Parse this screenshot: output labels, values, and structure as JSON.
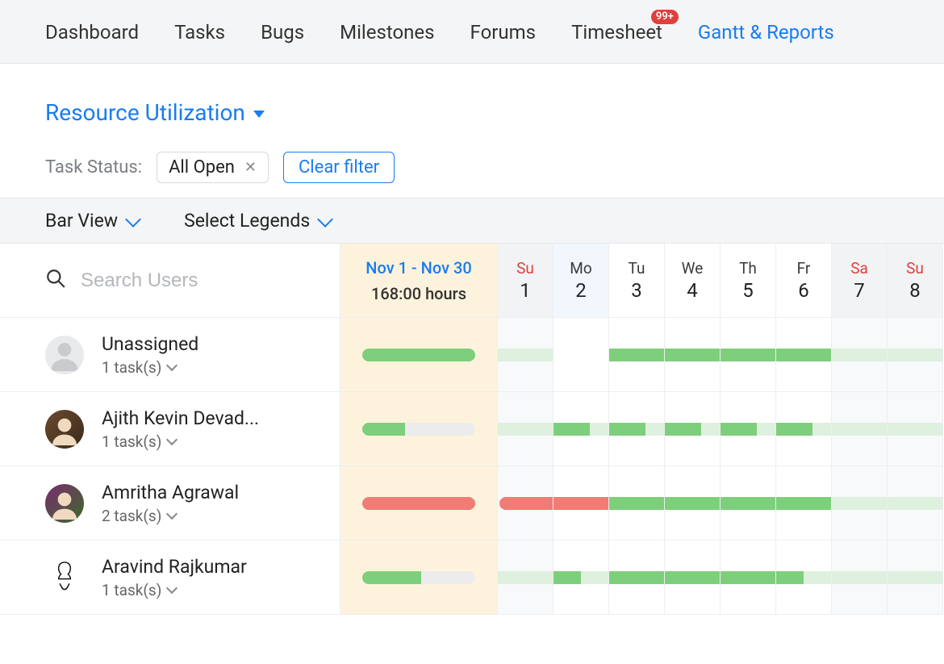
{
  "nav": {
    "items": [
      {
        "label": "Dashboard"
      },
      {
        "label": "Tasks"
      },
      {
        "label": "Bugs"
      },
      {
        "label": "Milestones"
      },
      {
        "label": "Forums"
      },
      {
        "label": "Timesheet",
        "badge": "99+"
      },
      {
        "label": "Gantt & Reports",
        "active": true
      }
    ]
  },
  "page": {
    "title": "Resource Utilization"
  },
  "filter": {
    "label": "Task Status:",
    "chip": "All Open",
    "clear": "Clear filter"
  },
  "view": {
    "mode": "Bar View",
    "legends": "Select Legends"
  },
  "search": {
    "placeholder": "Search Users"
  },
  "summary": {
    "range": "Nov 1 - Nov 30",
    "hours": "168:00 hours"
  },
  "days": [
    {
      "dow": "Su",
      "num": "1",
      "kind": "weekend"
    },
    {
      "dow": "Mo",
      "num": "2",
      "kind": "mon"
    },
    {
      "dow": "Tu",
      "num": "3",
      "kind": "day"
    },
    {
      "dow": "We",
      "num": "4",
      "kind": "day"
    },
    {
      "dow": "Th",
      "num": "5",
      "kind": "day"
    },
    {
      "dow": "Fr",
      "num": "6",
      "kind": "day"
    },
    {
      "dow": "Sa",
      "num": "7",
      "kind": "weekend"
    },
    {
      "dow": "Su",
      "num": "8",
      "kind": "weekend"
    }
  ],
  "users": [
    {
      "name": "Unassigned",
      "tasks": "1 task(s)",
      "avatar": "silhouette",
      "summary": {
        "segments": [
          {
            "color": "green",
            "w": 100
          }
        ]
      },
      "cells": [
        "light",
        "empty",
        "full",
        "full",
        "full",
        "full",
        "light",
        "light"
      ]
    },
    {
      "name": "Ajith Kevin Devad...",
      "tasks": "1 task(s)",
      "avatar": "photo",
      "summary": {
        "segments": [
          {
            "color": "green",
            "w": 38
          }
        ]
      },
      "cells": [
        "light",
        "major",
        "major",
        "major",
        "major",
        "major",
        "light",
        "light"
      ]
    },
    {
      "name": "Amritha Agrawal",
      "tasks": "2 task(s)",
      "avatar": "photo2",
      "summary": {
        "segments": [
          {
            "color": "red",
            "w": 100
          }
        ]
      },
      "cells": [
        "red",
        "red",
        "full",
        "full",
        "full",
        "full",
        "light",
        "light"
      ]
    },
    {
      "name": "Aravind Rajkumar",
      "tasks": "1 task(s)",
      "avatar": "sketch",
      "summary": {
        "segments": [
          {
            "color": "green",
            "w": 52
          }
        ]
      },
      "cells": [
        "light",
        "major2",
        "full",
        "full",
        "full",
        "major2",
        "light",
        "light"
      ]
    }
  ]
}
